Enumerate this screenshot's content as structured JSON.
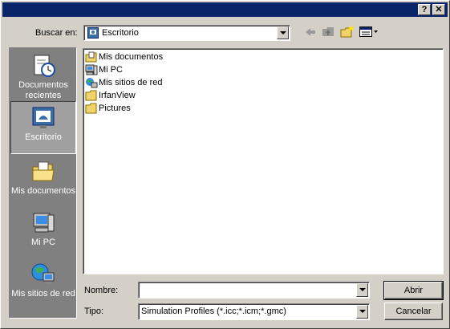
{
  "titlebar": {
    "help": "?",
    "close": "✕"
  },
  "lookin": {
    "label": "Buscar en:",
    "value": "Escritorio"
  },
  "toolbar": {
    "icons": [
      "back-icon",
      "up-folder-icon",
      "new-folder-icon",
      "view-menu-icon"
    ]
  },
  "places": [
    {
      "label": "Documentos recientes",
      "icon": "recent-documents-icon"
    },
    {
      "label": "Escritorio",
      "icon": "desktop-icon"
    },
    {
      "label": "Mis documentos",
      "icon": "my-documents-icon"
    },
    {
      "label": "Mi PC",
      "icon": "my-computer-icon"
    },
    {
      "label": "Mis sitios de red",
      "icon": "network-places-icon"
    }
  ],
  "files": [
    {
      "name": "Mis documentos",
      "icon": "my-documents-icon"
    },
    {
      "name": "Mi PC",
      "icon": "my-computer-icon"
    },
    {
      "name": "Mis sitios de red",
      "icon": "network-places-icon"
    },
    {
      "name": "IrfanView",
      "icon": "folder-icon"
    },
    {
      "name": "Pictures",
      "icon": "folder-icon"
    }
  ],
  "filename": {
    "label": "Nombre:",
    "value": ""
  },
  "filetype": {
    "label": "Tipo:",
    "value": "Simulation Profiles (*.icc;*.icm;*.gmc)"
  },
  "buttons": {
    "open": "Abrir",
    "cancel": "Cancelar"
  },
  "colors": {
    "titlebar": "#0a246a",
    "face": "#d4d0c8",
    "places_bg": "#808080"
  }
}
